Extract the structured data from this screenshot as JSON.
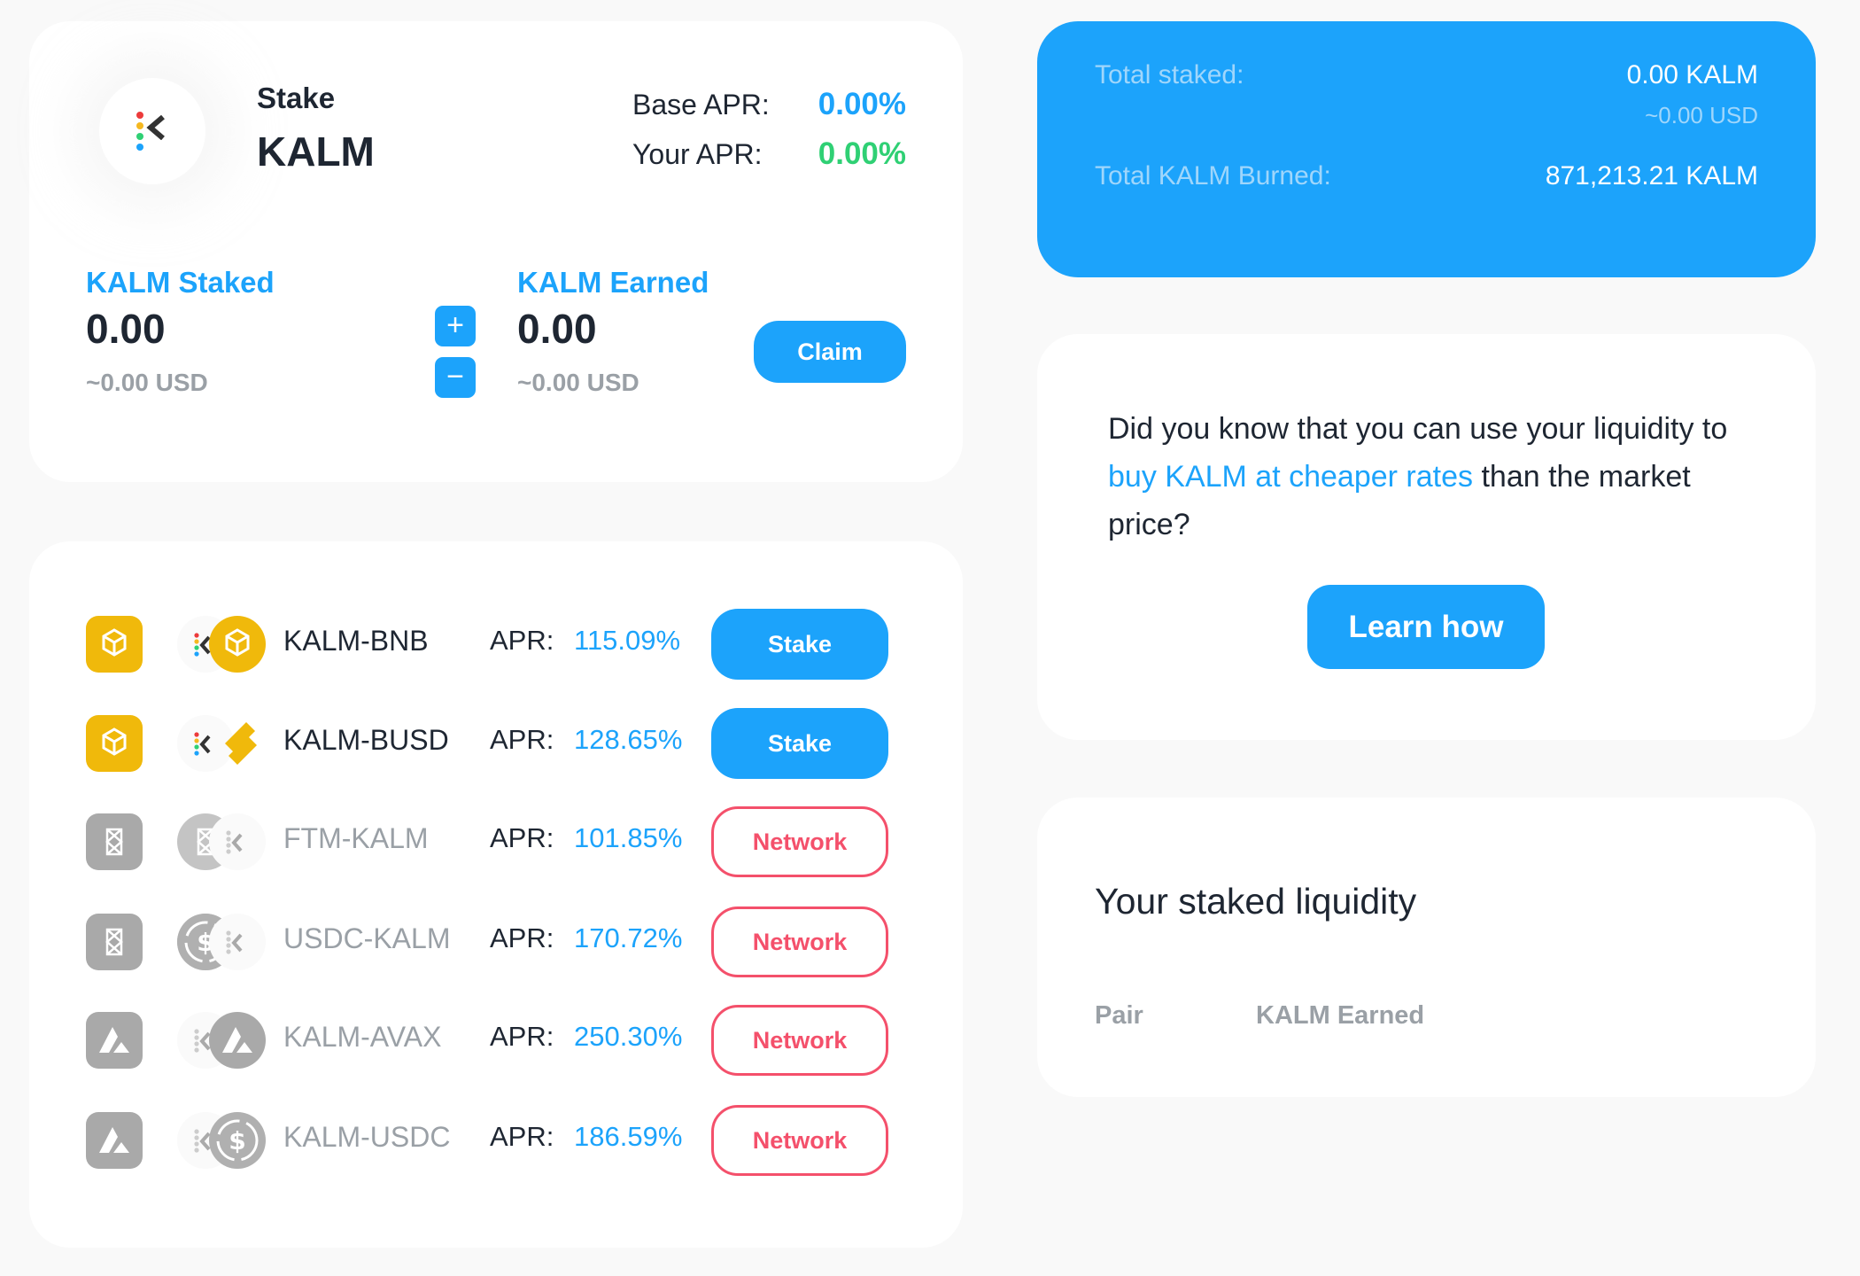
{
  "stake_card": {
    "title_small": "Stake",
    "title_token": "KALM",
    "base_apr_label": "Base APR:",
    "base_apr_value": "0.00%",
    "your_apr_label": "Your APR:",
    "your_apr_value": "0.00%",
    "staked_label": "KALM Staked",
    "staked_value": "0.00",
    "staked_usd": "~0.00 USD",
    "add_label": "+",
    "remove_label": "−",
    "earned_label": "KALM Earned",
    "earned_value": "0.00",
    "earned_usd": "~0.00 USD",
    "claim_label": "Claim"
  },
  "pools": [
    {
      "chain": "bnb-chain",
      "chain_color": "#f0b90b",
      "pair": "KALM-BNB",
      "apr_label": "APR:",
      "apr": "115.09%",
      "action": "Stake",
      "action_type": "stake",
      "active": true
    },
    {
      "chain": "bnb-chain",
      "chain_color": "#f0b90b",
      "pair": "KALM-BUSD",
      "apr_label": "APR:",
      "apr": "128.65%",
      "action": "Stake",
      "action_type": "stake",
      "active": true
    },
    {
      "chain": "fantom",
      "chain_color": "#a9a9a9",
      "pair": "FTM-KALM",
      "apr_label": "APR:",
      "apr": "101.85%",
      "action": "Network",
      "action_type": "network",
      "active": false
    },
    {
      "chain": "fantom",
      "chain_color": "#a9a9a9",
      "pair": "USDC-KALM",
      "apr_label": "APR:",
      "apr": "170.72%",
      "action": "Network",
      "action_type": "network",
      "active": false
    },
    {
      "chain": "avalanche",
      "chain_color": "#a9a9a9",
      "pair": "KALM-AVAX",
      "apr_label": "APR:",
      "apr": "250.30%",
      "action": "Network",
      "action_type": "network",
      "active": false
    },
    {
      "chain": "avalanche",
      "chain_color": "#a9a9a9",
      "pair": "KALM-USDC",
      "apr_label": "APR:",
      "apr": "186.59%",
      "action": "Network",
      "action_type": "network",
      "active": false
    }
  ],
  "summary": {
    "total_staked_label": "Total staked:",
    "total_staked_value": "0.00 KALM",
    "total_staked_usd": "~0.00 USD",
    "burned_label": "Total KALM Burned:",
    "burned_value": "871,213.21 KALM"
  },
  "info": {
    "text_before": "Did you know that you can use your liquidity to ",
    "link_text": "buy KALM at cheaper rates",
    "text_after": " than the market price?",
    "button_label": "Learn how"
  },
  "liquidity": {
    "title": "Your staked liquidity",
    "columns": [
      "Pair",
      "KALM Earned"
    ]
  },
  "colors": {
    "accent": "#1ca3fb",
    "positive": "#2fd074",
    "network_warning": "#f4506b",
    "bnb": "#f0b90b",
    "inactive": "#a9a9a9"
  }
}
